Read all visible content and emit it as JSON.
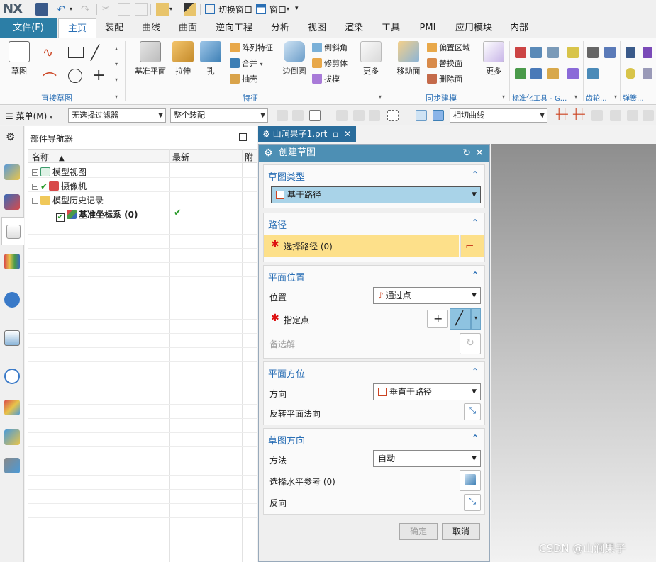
{
  "quick_access": {
    "logo": "NX",
    "switch_window": "切换窗口",
    "window_menu": "窗口"
  },
  "tabs": [
    "文件(F)",
    "主页",
    "装配",
    "曲线",
    "曲面",
    "逆向工程",
    "分析",
    "视图",
    "渲染",
    "工具",
    "PMI",
    "应用模块",
    "内部"
  ],
  "ribbon": {
    "sketch": "草图",
    "direct_sketch": "直接草图",
    "datum_plane": "基准平面",
    "extrude": "拉伸",
    "hole": "孔",
    "pattern_feature": "阵列特征",
    "unite": "合并",
    "shell": "抽壳",
    "edge_blend": "边倒圆",
    "chamfer": "倒斜角",
    "trim_body": "修剪体",
    "draft": "拔模",
    "more1": "更多",
    "feature": "特征",
    "move_face": "移动面",
    "offset_region": "偏置区域",
    "replace_face": "替换面",
    "delete_face": "删除面",
    "more2": "更多",
    "sync_modeling": "同步建模",
    "std_tools": "标准化工具 - G...",
    "gear": "齿轮...",
    "spring": "弹簧..."
  },
  "filter_bar": {
    "menu": "菜单(M)",
    "filter": "无选择过滤器",
    "scope": "整个装配",
    "curve_rule": "相切曲线"
  },
  "navigator": {
    "title": "部件导航器",
    "col_name": "名称",
    "col_latest": "最新",
    "col_third": "附",
    "items": [
      {
        "label": "模型视图"
      },
      {
        "label": "摄像机"
      },
      {
        "label": "模型历史记录"
      },
      {
        "label": "基准坐标系 (0)",
        "latest": "✔"
      }
    ]
  },
  "part_tab": {
    "label": "山涧果子1.prt"
  },
  "dialog": {
    "title": "创建草图",
    "sketch_type": {
      "header": "草图类型",
      "value": "基于路径"
    },
    "path": {
      "header": "路径",
      "select_path": "选择路径 (0)"
    },
    "plane_location": {
      "header": "平面位置",
      "location_label": "位置",
      "location_value": "通过点",
      "specify_point": "指定点",
      "alternate": "备选解"
    },
    "plane_orientation": {
      "header": "平面方位",
      "direction_label": "方向",
      "direction_value": "垂直于路径",
      "reverse_normal": "反转平面法向"
    },
    "sketch_orientation": {
      "header": "草图方向",
      "method_label": "方法",
      "method_value": "自动",
      "horizontal_ref": "选择水平参考 (0)",
      "reverse": "反向"
    },
    "ok": "确定",
    "cancel": "取消"
  },
  "watermark": "CSDN @山涧果子",
  "colors": {
    "accent_blue": "#2a6fb5",
    "dialog_title": "#4d8fb4",
    "required_highlight": "#fde08a",
    "sketch_type_select": "#a9d3e8"
  }
}
